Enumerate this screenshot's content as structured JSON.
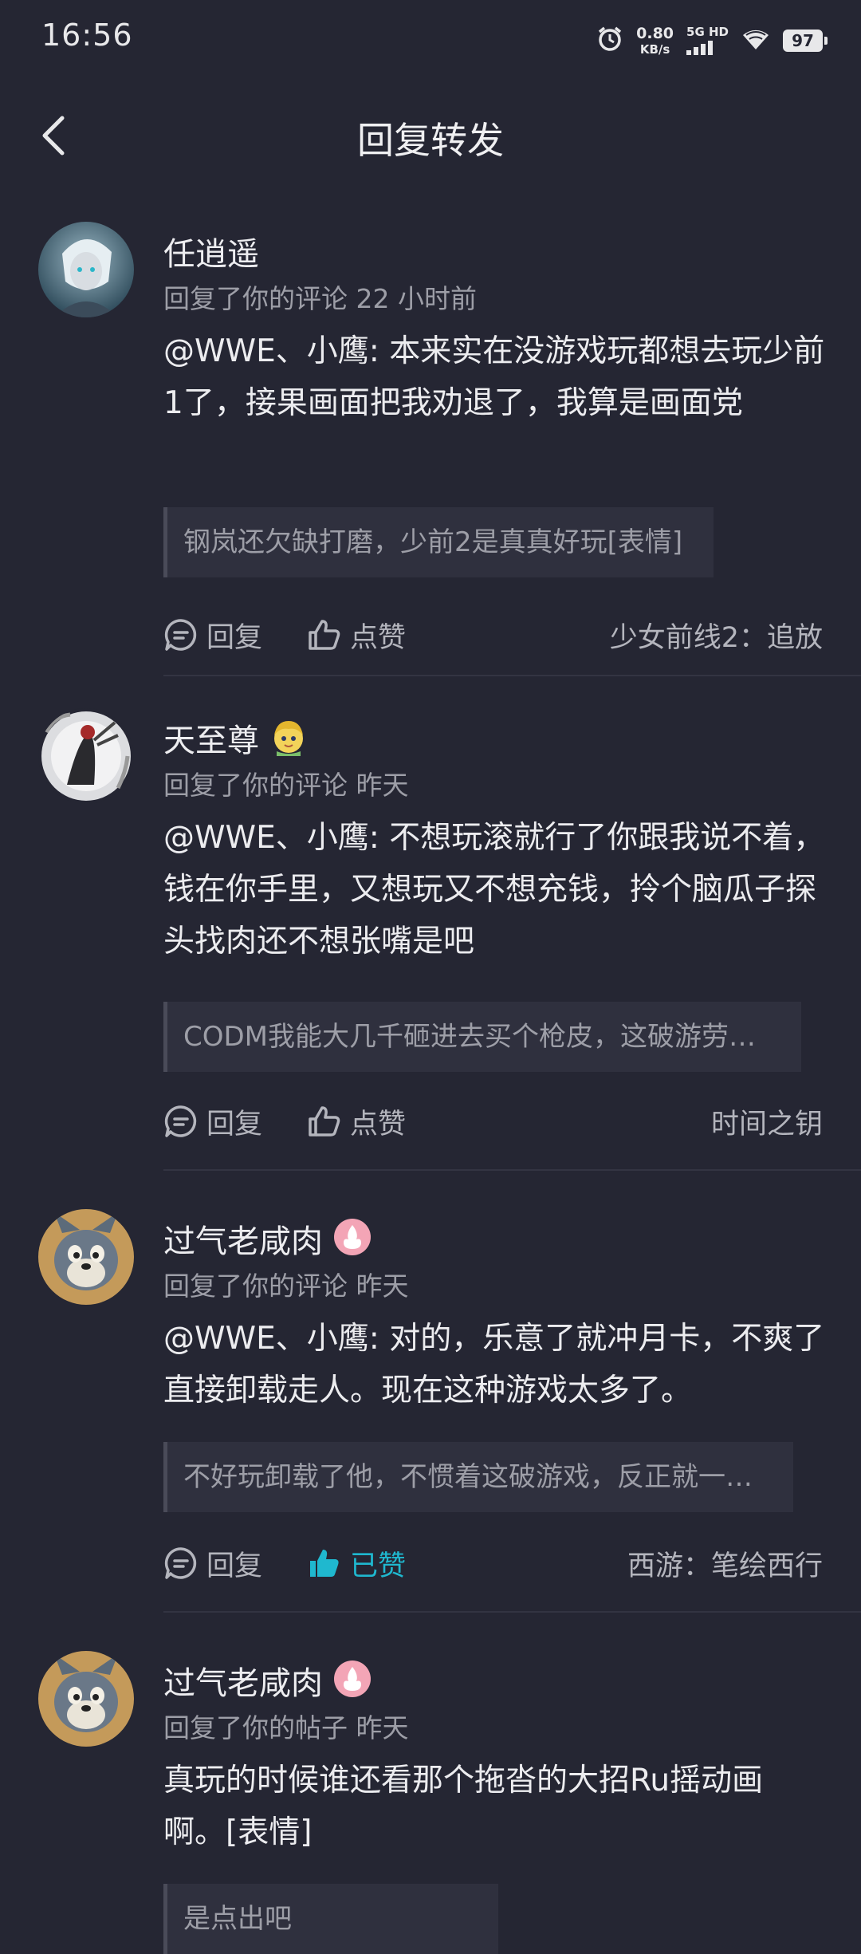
{
  "status_bar": {
    "time": "16:56",
    "net_speed_value": "0.80",
    "net_speed_unit": "KB/s",
    "signal_label": "5G HD",
    "battery": "97",
    "icons": [
      "alarm-icon",
      "signal-icon",
      "wifi-icon",
      "battery-icon"
    ]
  },
  "header": {
    "title": "回复转发",
    "back_icon": "chevron-left-icon"
  },
  "actions": {
    "reply_label": "回复",
    "like_label": "点赞",
    "liked_label": "已赞"
  },
  "colors": {
    "background": "#252633",
    "accent_liked": "#1fb8cf"
  },
  "items": [
    {
      "name": "任逍遥",
      "meta": "回复了你的评论 22 小时前",
      "body": "@WWE、小鹰: 本来实在没游戏玩都想去玩少前1了，接果画面把我劝退了，我算是画面党",
      "quote": "钢岚还欠缺打磨，少前2是真真好玩[表情]",
      "source": "少女前线2：追放",
      "liked": false
    },
    {
      "name": "天至尊",
      "meta": "回复了你的评论 昨天",
      "body": "@WWE、小鹰: 不想玩滚就行了你跟我说不着，钱在你手里，又想玩又不想充钱，拎个脑瓜子探头找肉还不想张嘴是吧",
      "quote": "CODM我能大几千砸进去买个枪皮，这破游劳…",
      "source": "时间之钥",
      "liked": false
    },
    {
      "name": "过气老咸肉",
      "meta": "回复了你的评论 昨天",
      "body": "@WWE、小鹰: 对的，乐意了就冲月卡，不爽了直接卸载走人。现在这种游戏太多了。",
      "quote": "不好玩卸载了他，不惯着这破游戏，反正就一…",
      "source": "西游：笔绘西行",
      "liked": true
    },
    {
      "name": "过气老咸肉",
      "meta": "回复了你的帖子 昨天",
      "body": "真玩的时候谁还看那个拖沓的大招Ru摇动画啊。[表情]",
      "quote": "是点出吧",
      "source": "",
      "liked": false
    }
  ]
}
